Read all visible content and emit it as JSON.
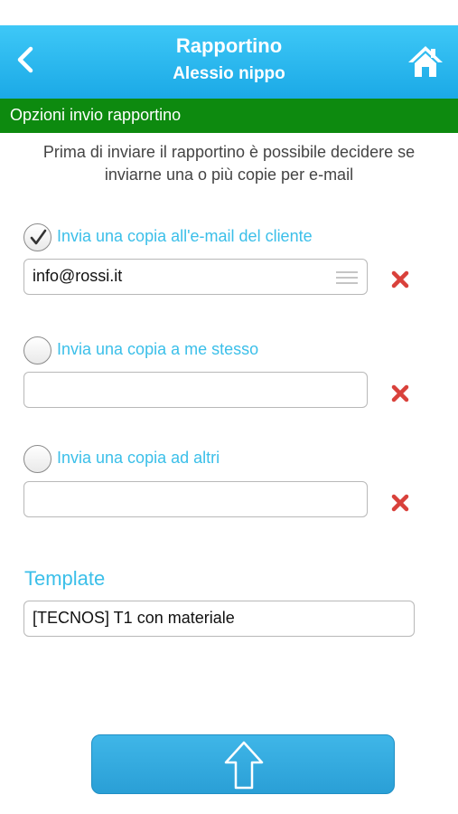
{
  "header": {
    "title": "Rapportino",
    "subtitle": "Alessio nippo",
    "back_icon": "chevron-left-icon",
    "home_icon": "home-icon"
  },
  "section_title": "Opzioni invio rapportino",
  "intro_text": {
    "line1": "Prima di inviare il rapportino è possibile decidere se",
    "line2": "inviarne una o più copie per e-mail"
  },
  "options": [
    {
      "label": "Invia una copia all'e-mail del cliente",
      "checked": true,
      "value": "info@rossi.it"
    },
    {
      "label": "Invia una copia a me stesso",
      "checked": false,
      "value": ""
    },
    {
      "label": "Invia una copia ad altri",
      "checked": false,
      "value": ""
    }
  ],
  "template": {
    "label": "Template",
    "value": "[TECNOS] T1 con materiale"
  },
  "submit_icon": "arrow-up-icon",
  "colors": {
    "header_top": "#3ec8f7",
    "header_bottom": "#1ba9e6",
    "section_bar": "#0d8a0f",
    "accent_text": "#3bbfe9",
    "delete_red": "#d9413b"
  }
}
